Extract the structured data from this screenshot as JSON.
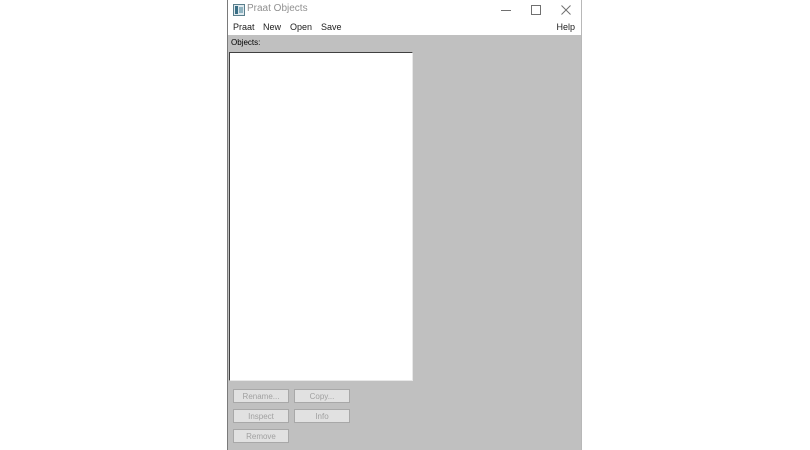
{
  "window": {
    "title": "Praat Objects",
    "icons": {
      "app": "praat-app-icon",
      "minimize": "minimize-icon",
      "maximize": "maximize-icon",
      "close": "close-icon"
    }
  },
  "menubar": {
    "items": [
      "Praat",
      "New",
      "Open",
      "Save"
    ],
    "help": "Help"
  },
  "objects": {
    "label": "Objects:",
    "items": []
  },
  "buttons": {
    "rename": "Rename...",
    "copy": "Copy...",
    "inspect": "Inspect",
    "info": "Info",
    "remove": "Remove"
  },
  "colors": {
    "window_background": "#c0c0c0",
    "list_background": "#ffffff",
    "disabled_text": "#a0a0a0"
  }
}
